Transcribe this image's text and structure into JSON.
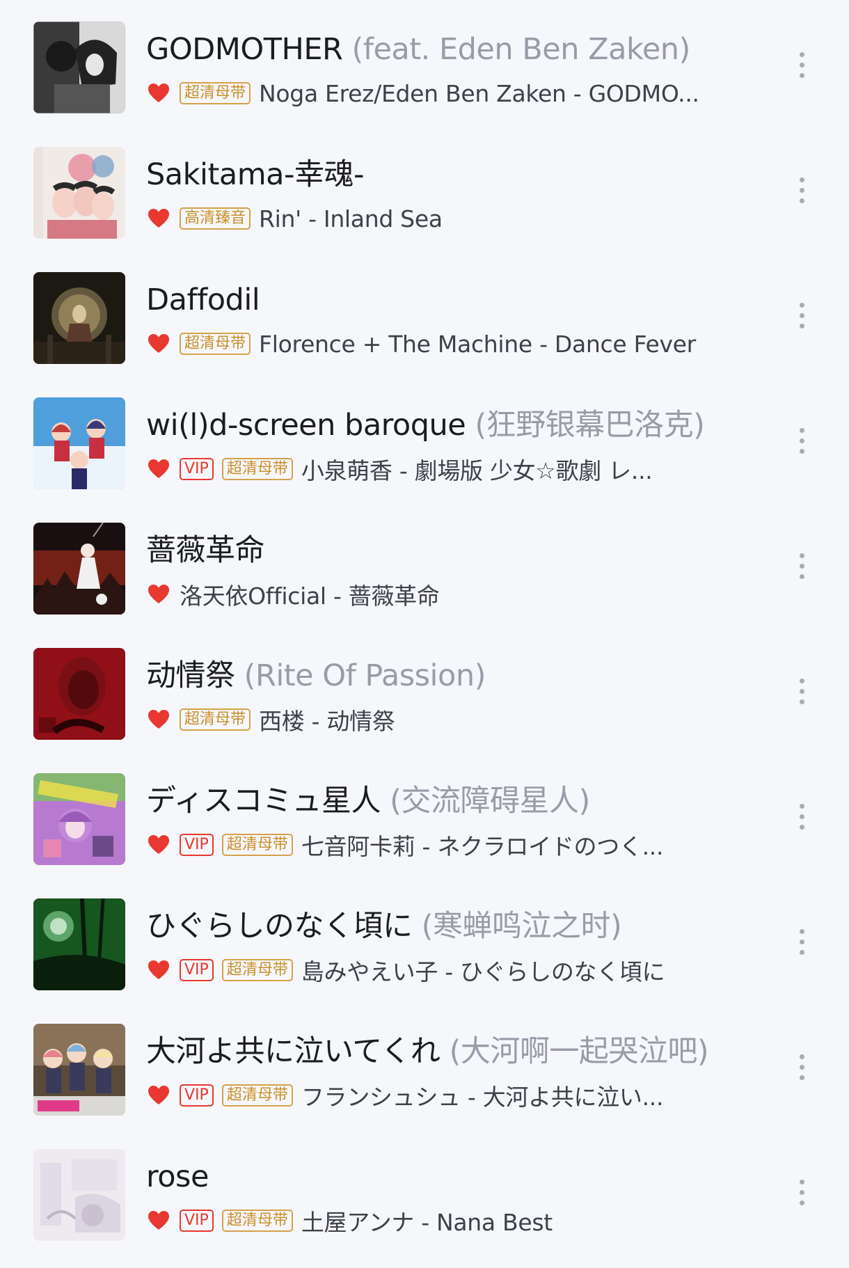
{
  "colors": {
    "background": "#f6f7fb",
    "heart": "#e8382f",
    "vip_tag": "#e8382f",
    "quality_tag": "#c9902a",
    "title": "#1b1c22",
    "alt_title": "#9a9ba6",
    "artist": "#3f4048"
  },
  "songs": [
    {
      "title": "GODMOTHER",
      "alt_title": " (feat. Eden Ben Zaken)",
      "liked": true,
      "vip": "",
      "quality": "超清母带",
      "artist_album": "Noga Erez/Eden Ben Zaken - GODMO...",
      "more_icon": "more-vertical-icon"
    },
    {
      "title": "Sakitama-幸魂-",
      "alt_title": "",
      "liked": true,
      "vip": "",
      "quality": "高清臻音",
      "artist_album": "Rin' - Inland Sea",
      "more_icon": "more-vertical-icon"
    },
    {
      "title": "Daffodil",
      "alt_title": "",
      "liked": true,
      "vip": "",
      "quality": "超清母带",
      "artist_album": "Florence + The Machine - Dance Fever",
      "more_icon": "more-vertical-icon"
    },
    {
      "title": "wi(l)d-screen baroque",
      "alt_title": " (狂野银幕巴洛克)",
      "liked": true,
      "vip": "VIP",
      "quality": "超清母带",
      "artist_album": "小泉萌香 - 劇場版 少女☆歌劇 レ...",
      "more_icon": "more-vertical-icon"
    },
    {
      "title": "蔷薇革命",
      "alt_title": "",
      "liked": true,
      "vip": "",
      "quality": "",
      "artist_album": "洛天依Official - 蔷薇革命",
      "more_icon": "more-vertical-icon"
    },
    {
      "title": "动情祭",
      "alt_title": " (Rite Of Passion)",
      "liked": true,
      "vip": "",
      "quality": "超清母带",
      "artist_album": "西楼 - 动情祭",
      "more_icon": "more-vertical-icon"
    },
    {
      "title": "ディスコミュ星人",
      "alt_title": " (交流障碍星人)",
      "liked": true,
      "vip": "VIP",
      "quality": "超清母带",
      "artist_album": "七音阿卡莉 - ネクラロイドのつく...",
      "more_icon": "more-vertical-icon"
    },
    {
      "title": "ひぐらしのなく頃に",
      "alt_title": " (寒蝉鸣泣之时)",
      "liked": true,
      "vip": "VIP",
      "quality": "超清母带",
      "artist_album": "島みやえい子 - ひぐらしのなく頃に",
      "more_icon": "more-vertical-icon"
    },
    {
      "title": "大河よ共に泣いてくれ",
      "alt_title": " (大河啊一起哭泣吧)",
      "liked": true,
      "vip": "VIP",
      "quality": "超清母带",
      "artist_album": "フランシュシュ - 大河よ共に泣い...",
      "more_icon": "more-vertical-icon"
    },
    {
      "title": "rose",
      "alt_title": "",
      "liked": true,
      "vip": "VIP",
      "quality": "超清母带",
      "artist_album": "土屋アンナ - Nana Best",
      "more_icon": "more-vertical-icon"
    }
  ]
}
